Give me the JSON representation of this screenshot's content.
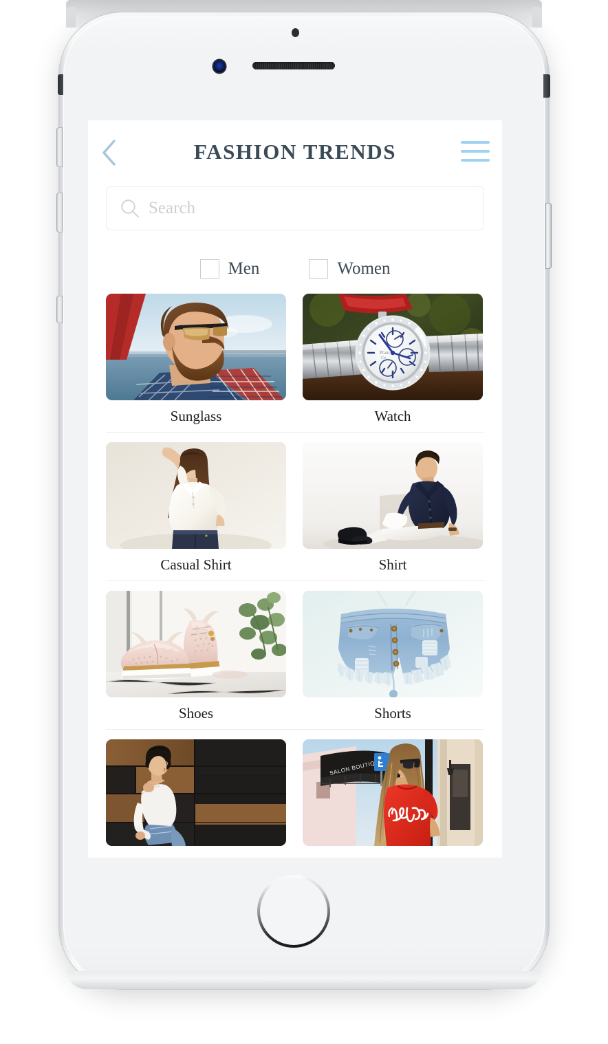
{
  "device": {
    "type": "white-smartphone-mockup",
    "home_button": "home-button",
    "front_camera": "front-camera-icon",
    "speaker": "speaker-grille",
    "sensor": "proximity-sensor-icon",
    "buttons": {
      "silent_switch": "silent-switch",
      "volume_up": "volume-up-button",
      "volume_down": "volume-down-button",
      "power": "power-button"
    }
  },
  "header": {
    "title": "FASHION TRENDS",
    "back_icon": "chevron-left-icon",
    "menu_icon": "hamburger-menu-icon",
    "title_color": "#3a4a57",
    "accent_color": "#9fd2f0"
  },
  "search": {
    "placeholder": "Search",
    "value": "",
    "icon": "search-icon"
  },
  "filters": [
    {
      "label": "Men",
      "checked": false
    },
    {
      "label": "Women",
      "checked": false
    }
  ],
  "grid": {
    "rows": [
      {
        "cards": [
          {
            "label": "Sunglass",
            "image": "bearded-man-wearing-sunglasses-on-boat"
          },
          {
            "label": "Watch",
            "image": "silver-chronograph-wristwatch-on-wood"
          }
        ]
      },
      {
        "cards": [
          {
            "label": "Casual Shirt",
            "image": "woman-in-white-blouse-and-dark-jeans"
          },
          {
            "label": "Shirt",
            "image": "man-in-navy-shirt-and-white-trousers"
          }
        ]
      },
      {
        "cards": [
          {
            "label": "Shoes",
            "image": "blush-pink-brogue-shoes-with-gold-trim"
          },
          {
            "label": "Shorts",
            "image": "light-denim-distressed-cutoff-shorts"
          }
        ]
      },
      {
        "cards": [
          {
            "label": "",
            "image": "woman-in-white-off-shoulder-top-by-panel-wall"
          },
          {
            "label": "",
            "image": "woman-in-red-infuse-tshirt-on-street"
          }
        ]
      }
    ]
  },
  "colors": {
    "screen_bg": "#ffffff",
    "divider": "#ededed",
    "label_text": "#1c1c1c",
    "placeholder_text": "#cfcfcf",
    "device_body": "#f3f4f5"
  }
}
